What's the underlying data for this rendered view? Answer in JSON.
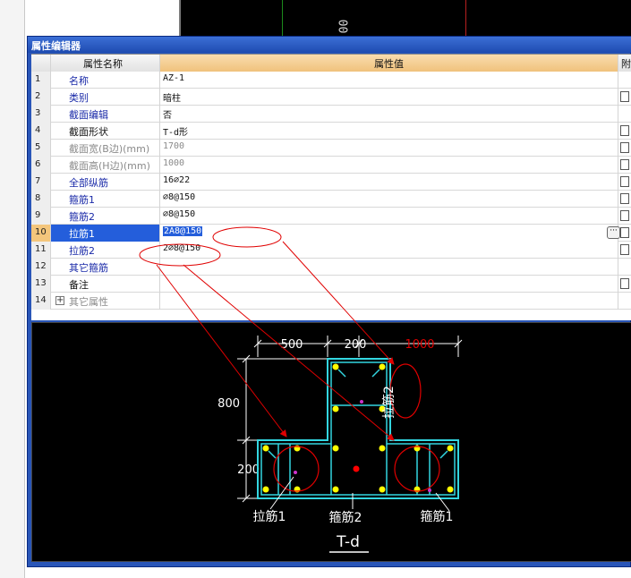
{
  "background": {
    "cad_label": "00"
  },
  "window": {
    "title": "属性编辑器"
  },
  "grid": {
    "headers": {
      "name": "属性名称",
      "value": "属性值",
      "attach": "附"
    },
    "rows": [
      {
        "num": "1",
        "name": "名称",
        "value": "AZ-1"
      },
      {
        "num": "2",
        "name": "类别",
        "value": "暗柱"
      },
      {
        "num": "3",
        "name": "截面编辑",
        "value": "否"
      },
      {
        "num": "4",
        "name": "截面形状",
        "value": "T-d形"
      },
      {
        "num": "5",
        "name": "截面宽(B边)(mm)",
        "value": "1700"
      },
      {
        "num": "6",
        "name": "截面高(H边)(mm)",
        "value": "1000"
      },
      {
        "num": "7",
        "name": "全部纵筋",
        "value": "16⌀22"
      },
      {
        "num": "8",
        "name": "箍筋1",
        "value": "⌀8@150"
      },
      {
        "num": "9",
        "name": "箍筋2",
        "value": "⌀8@150"
      },
      {
        "num": "10",
        "name": "拉筋1",
        "value": "2A8@150"
      },
      {
        "num": "11",
        "name": "拉筋2",
        "value": "2⌀8@150"
      },
      {
        "num": "12",
        "name": "其它箍筋",
        "value": ""
      },
      {
        "num": "13",
        "name": "备注",
        "value": ""
      },
      {
        "num": "14",
        "name": "其它属性",
        "value": "",
        "expand": "+"
      }
    ],
    "ellipsis": "···"
  },
  "drawing": {
    "dims_top": [
      "500",
      "200",
      "1000"
    ],
    "dim_left_top": "800",
    "dim_left_bottom": "200",
    "label_tie1_left": "拉筋1",
    "label_stirrup2": "箍筋2",
    "label_stirrup1": "箍筋1",
    "label_tie2": "拉筋2",
    "section_name": "T-d",
    "colors": {
      "outline": "#33d6e0",
      "rebar": "#ffff00",
      "center": "#ff0000",
      "annotation": "#e00000",
      "dim_highlight": "#e00000"
    }
  }
}
